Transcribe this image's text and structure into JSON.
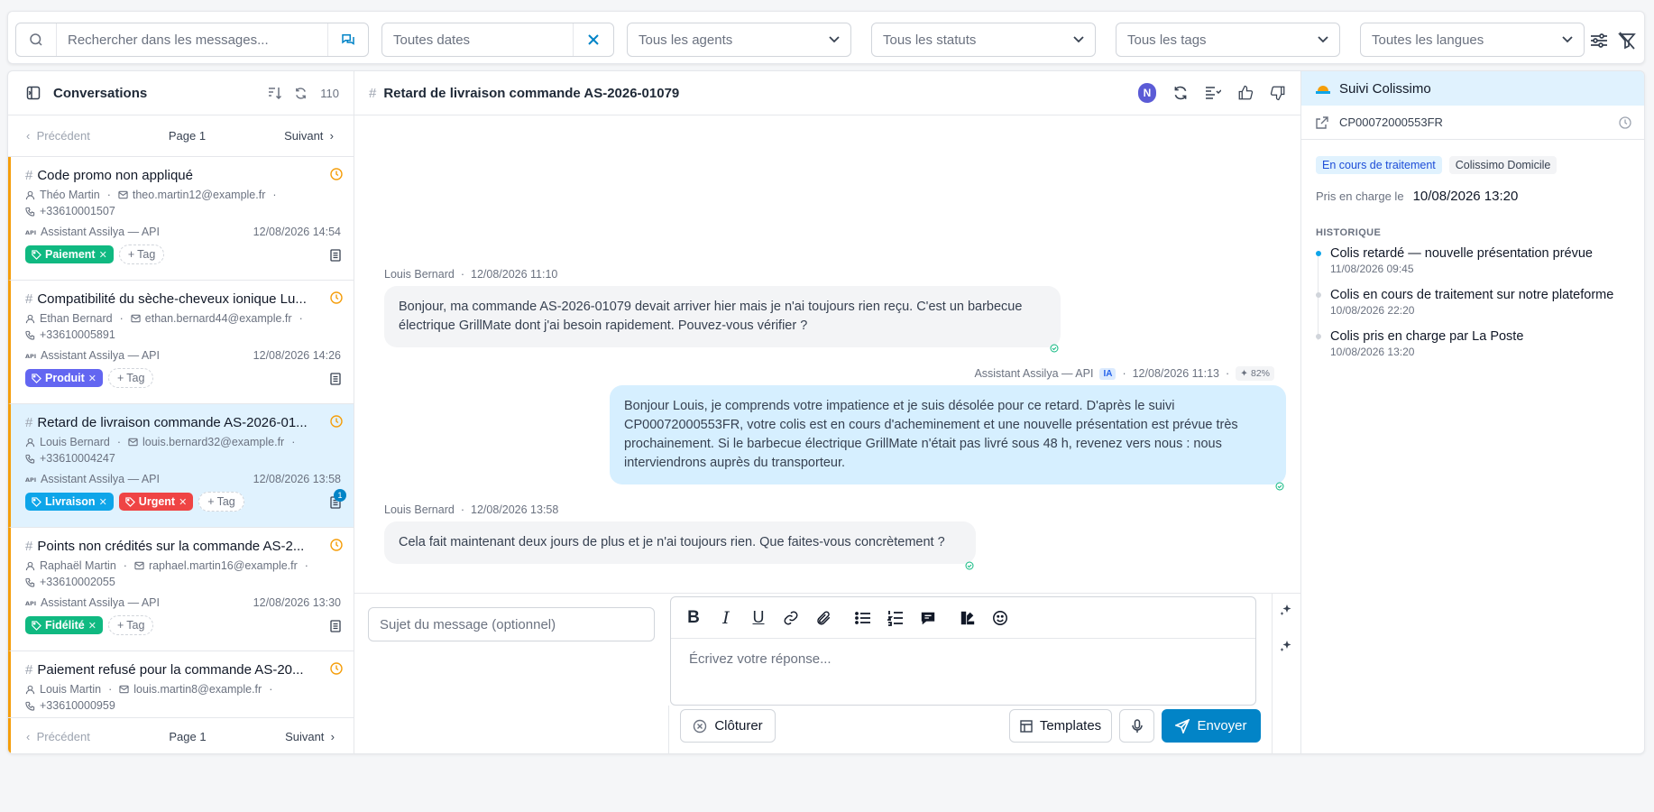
{
  "filters": {
    "search_placeholder": "Rechercher dans les messages...",
    "dates": "Toutes dates",
    "agents": "Tous les agents",
    "statuts": "Tous les statuts",
    "tags": "Tous les tags",
    "langues": "Toutes les langues"
  },
  "sidebar": {
    "title": "Conversations",
    "count": "110",
    "pager": {
      "prev": "Précédent",
      "page": "Page 1",
      "next": "Suivant"
    },
    "conversations": [
      {
        "title": "Code promo non appliqué",
        "name": "Théo Martin",
        "email": "theo.martin12@example.fr",
        "phone": "+33610001507",
        "agent": "Assistant Assilya — API",
        "date": "12/08/2026 14:54",
        "tags": [
          {
            "label": "Paiement",
            "color": "#10b981"
          }
        ]
      },
      {
        "title": "Compatibilité du sèche-cheveux ionique Lu...",
        "name": "Ethan Bernard",
        "email": "ethan.bernard44@example.fr",
        "phone": "+33610005891",
        "agent": "Assistant Assilya — API",
        "date": "12/08/2026 14:26",
        "tags": [
          {
            "label": "Produit",
            "color": "#6366f1"
          }
        ]
      },
      {
        "title": "Retard de livraison commande AS-2026-01...",
        "name": "Louis Bernard",
        "email": "louis.bernard32@example.fr",
        "phone": "+33610004247",
        "agent": "Assistant Assilya — API",
        "date": "12/08/2026 13:58",
        "tags": [
          {
            "label": "Livraison",
            "color": "#0ea5e9"
          },
          {
            "label": "Urgent",
            "color": "#ef4444"
          }
        ],
        "badge": "1"
      },
      {
        "title": "Points non crédités sur la commande AS-2...",
        "name": "Raphaël Martin",
        "email": "raphael.martin16@example.fr",
        "phone": "+33610002055",
        "agent": "Assistant Assilya — API",
        "date": "12/08/2026 13:30",
        "tags": [
          {
            "label": "Fidélité",
            "color": "#10b981"
          }
        ]
      },
      {
        "title": "Paiement refusé pour la commande AS-20...",
        "name": "Louis Martin",
        "email": "louis.martin8@example.fr",
        "phone": "+33610000959"
      }
    ],
    "add_tag": "Tag"
  },
  "chat": {
    "title": "Retard de livraison commande AS-2026-01079",
    "avatar": "N",
    "messages": [
      {
        "author": "Louis Bernard",
        "time": "12/08/2026 11:10",
        "text": "Bonjour, ma commande AS-2026-01079 devait arriver hier mais je n'ai toujours rien reçu. C'est un barbecue électrique GrillMate dont j'ai besoin rapidement. Pouvez-vous vérifier ?"
      },
      {
        "author": "Assistant Assilya — API",
        "ia": "IA",
        "time": "12/08/2026 11:13",
        "confidence": "82%",
        "text": "Bonjour Louis, je comprends votre impatience et je suis désolée pour ce retard. D'après le suivi CP00072000553FR, votre colis est en cours d'acheminement et une nouvelle présentation est prévue très prochainement. Si le barbecue électrique GrillMate n'était pas livré sous 48 h, revenez vers nous : nous interviendrons auprès du transporteur."
      },
      {
        "author": "Louis Bernard",
        "time": "12/08/2026 13:58",
        "text": "Cela fait maintenant deux jours de plus et je n'ai toujours rien. Que faites-vous concrètement ?"
      }
    ],
    "composer": {
      "subject_placeholder": "Sujet du message (optionnel)",
      "reply_placeholder": "Écrivez votre réponse...",
      "close_label": "Clôturer",
      "templates_label": "Templates",
      "send_label": "Envoyer"
    }
  },
  "tracking": {
    "title": "Suivi Colissimo",
    "number": "CP00072000553FR",
    "status_chip": "En cours de traitement",
    "service_chip": "Colissimo Domicile",
    "taken_label": "Pris en charge le",
    "taken_value": "10/08/2026 13:20",
    "history_label": "HISTORIQUE",
    "history": [
      {
        "text": "Colis retardé — nouvelle présentation prévue",
        "date": "11/08/2026 09:45"
      },
      {
        "text": "Colis en cours de traitement sur notre plateforme",
        "date": "10/08/2026 22:20"
      },
      {
        "text": "Colis pris en charge par La Poste",
        "date": "10/08/2026 13:20"
      }
    ]
  },
  "colors": {
    "accent": "#0284c7",
    "active_row": "#e0f2fe",
    "outgoing_bubble": "#d6efff",
    "unread_stripe": "#f59e0b"
  }
}
